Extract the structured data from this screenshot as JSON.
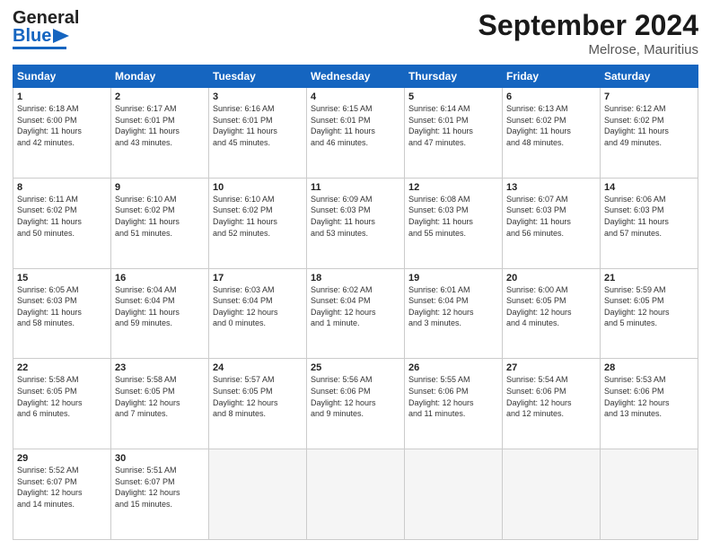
{
  "header": {
    "logo_top": "General",
    "logo_bottom": "Blue",
    "month_title": "September 2024",
    "subtitle": "Melrose, Mauritius"
  },
  "days_of_week": [
    "Sunday",
    "Monday",
    "Tuesday",
    "Wednesday",
    "Thursday",
    "Friday",
    "Saturday"
  ],
  "weeks": [
    [
      {
        "day": "1",
        "info": "Sunrise: 6:18 AM\nSunset: 6:00 PM\nDaylight: 11 hours\nand 42 minutes."
      },
      {
        "day": "2",
        "info": "Sunrise: 6:17 AM\nSunset: 6:01 PM\nDaylight: 11 hours\nand 43 minutes."
      },
      {
        "day": "3",
        "info": "Sunrise: 6:16 AM\nSunset: 6:01 PM\nDaylight: 11 hours\nand 45 minutes."
      },
      {
        "day": "4",
        "info": "Sunrise: 6:15 AM\nSunset: 6:01 PM\nDaylight: 11 hours\nand 46 minutes."
      },
      {
        "day": "5",
        "info": "Sunrise: 6:14 AM\nSunset: 6:01 PM\nDaylight: 11 hours\nand 47 minutes."
      },
      {
        "day": "6",
        "info": "Sunrise: 6:13 AM\nSunset: 6:02 PM\nDaylight: 11 hours\nand 48 minutes."
      },
      {
        "day": "7",
        "info": "Sunrise: 6:12 AM\nSunset: 6:02 PM\nDaylight: 11 hours\nand 49 minutes."
      }
    ],
    [
      {
        "day": "8",
        "info": "Sunrise: 6:11 AM\nSunset: 6:02 PM\nDaylight: 11 hours\nand 50 minutes."
      },
      {
        "day": "9",
        "info": "Sunrise: 6:10 AM\nSunset: 6:02 PM\nDaylight: 11 hours\nand 51 minutes."
      },
      {
        "day": "10",
        "info": "Sunrise: 6:10 AM\nSunset: 6:02 PM\nDaylight: 11 hours\nand 52 minutes."
      },
      {
        "day": "11",
        "info": "Sunrise: 6:09 AM\nSunset: 6:03 PM\nDaylight: 11 hours\nand 53 minutes."
      },
      {
        "day": "12",
        "info": "Sunrise: 6:08 AM\nSunset: 6:03 PM\nDaylight: 11 hours\nand 55 minutes."
      },
      {
        "day": "13",
        "info": "Sunrise: 6:07 AM\nSunset: 6:03 PM\nDaylight: 11 hours\nand 56 minutes."
      },
      {
        "day": "14",
        "info": "Sunrise: 6:06 AM\nSunset: 6:03 PM\nDaylight: 11 hours\nand 57 minutes."
      }
    ],
    [
      {
        "day": "15",
        "info": "Sunrise: 6:05 AM\nSunset: 6:03 PM\nDaylight: 11 hours\nand 58 minutes."
      },
      {
        "day": "16",
        "info": "Sunrise: 6:04 AM\nSunset: 6:04 PM\nDaylight: 11 hours\nand 59 minutes."
      },
      {
        "day": "17",
        "info": "Sunrise: 6:03 AM\nSunset: 6:04 PM\nDaylight: 12 hours\nand 0 minutes."
      },
      {
        "day": "18",
        "info": "Sunrise: 6:02 AM\nSunset: 6:04 PM\nDaylight: 12 hours\nand 1 minute."
      },
      {
        "day": "19",
        "info": "Sunrise: 6:01 AM\nSunset: 6:04 PM\nDaylight: 12 hours\nand 3 minutes."
      },
      {
        "day": "20",
        "info": "Sunrise: 6:00 AM\nSunset: 6:05 PM\nDaylight: 12 hours\nand 4 minutes."
      },
      {
        "day": "21",
        "info": "Sunrise: 5:59 AM\nSunset: 6:05 PM\nDaylight: 12 hours\nand 5 minutes."
      }
    ],
    [
      {
        "day": "22",
        "info": "Sunrise: 5:58 AM\nSunset: 6:05 PM\nDaylight: 12 hours\nand 6 minutes."
      },
      {
        "day": "23",
        "info": "Sunrise: 5:58 AM\nSunset: 6:05 PM\nDaylight: 12 hours\nand 7 minutes."
      },
      {
        "day": "24",
        "info": "Sunrise: 5:57 AM\nSunset: 6:05 PM\nDaylight: 12 hours\nand 8 minutes."
      },
      {
        "day": "25",
        "info": "Sunrise: 5:56 AM\nSunset: 6:06 PM\nDaylight: 12 hours\nand 9 minutes."
      },
      {
        "day": "26",
        "info": "Sunrise: 5:55 AM\nSunset: 6:06 PM\nDaylight: 12 hours\nand 11 minutes."
      },
      {
        "day": "27",
        "info": "Sunrise: 5:54 AM\nSunset: 6:06 PM\nDaylight: 12 hours\nand 12 minutes."
      },
      {
        "day": "28",
        "info": "Sunrise: 5:53 AM\nSunset: 6:06 PM\nDaylight: 12 hours\nand 13 minutes."
      }
    ],
    [
      {
        "day": "29",
        "info": "Sunrise: 5:52 AM\nSunset: 6:07 PM\nDaylight: 12 hours\nand 14 minutes."
      },
      {
        "day": "30",
        "info": "Sunrise: 5:51 AM\nSunset: 6:07 PM\nDaylight: 12 hours\nand 15 minutes."
      },
      {
        "day": "",
        "info": ""
      },
      {
        "day": "",
        "info": ""
      },
      {
        "day": "",
        "info": ""
      },
      {
        "day": "",
        "info": ""
      },
      {
        "day": "",
        "info": ""
      }
    ]
  ]
}
